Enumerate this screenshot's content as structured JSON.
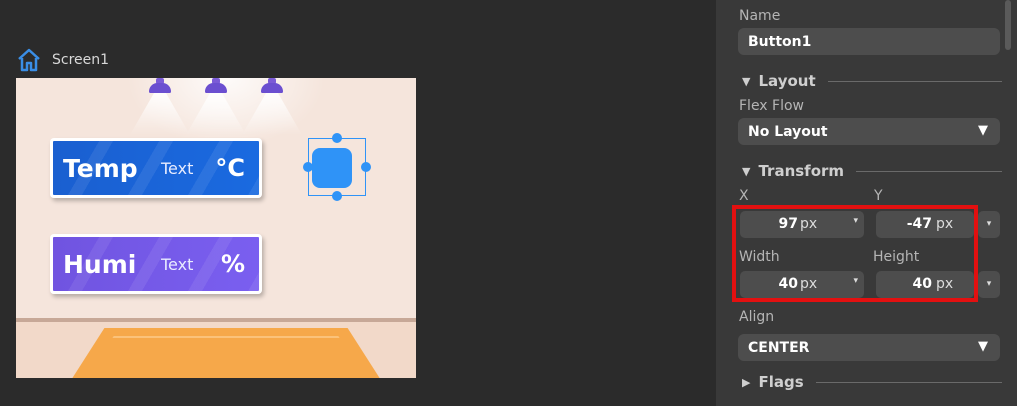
{
  "canvas": {
    "screen_name": "Screen1",
    "temp_sign": {
      "title": "Temp",
      "text": "Text",
      "unit": "°C"
    },
    "humi_sign": {
      "title": "Humi",
      "text": "Text",
      "unit": "%"
    }
  },
  "panel": {
    "name_label": "Name",
    "name_value": "Button1",
    "layout_section": "Layout",
    "flex_flow_label": "Flex Flow",
    "flex_flow_value": "No Layout",
    "transform_section": "Transform",
    "x_label": "X",
    "y_label": "Y",
    "x_value": "97",
    "y_value": "-47",
    "width_label": "Width",
    "height_label": "Height",
    "width_value": "40",
    "height_value": "40",
    "unit": "px",
    "align_label": "Align",
    "align_value": "CENTER",
    "flags_section": "Flags"
  },
  "colors": {
    "highlight": "#e31010",
    "selection": "#2f93f7",
    "temp_sign": "#1a5fd0",
    "humi_sign": "#7054e0"
  }
}
